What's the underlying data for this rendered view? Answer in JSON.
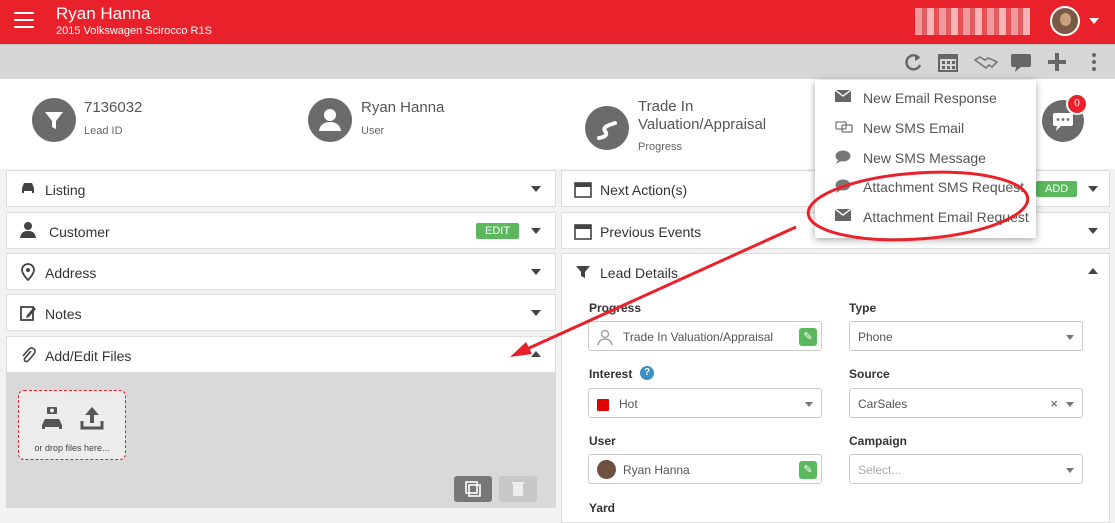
{
  "header": {
    "name": "Ryan Hanna",
    "vehicle": "2015 Volkswagen Scirocco R1S"
  },
  "toolbar": {
    "icons": [
      "refresh-icon",
      "calendar-icon",
      "handshake-icon",
      "chat-icon",
      "plus-icon",
      "more-vertical-icon"
    ]
  },
  "summary": {
    "lead": {
      "value": "7136032",
      "label": "Lead ID"
    },
    "user": {
      "value": "Ryan Hanna",
      "label": "User"
    },
    "progress": {
      "value_line1": "Trade In",
      "value_line2": "Valuation/Appraisal",
      "label": "Progress"
    },
    "chat_badge": "0"
  },
  "left_panels": {
    "listing": "Listing",
    "customer": "Customer",
    "customer_edit": "EDIT",
    "address": "Address",
    "notes": "Notes",
    "files": "Add/Edit Files",
    "dropzone_text": "or drop files here..."
  },
  "right_panels": {
    "next_actions": "Next Action(s)",
    "add": "ADD",
    "previous_events": "Previous Events",
    "lead_details": "Lead Details"
  },
  "lead_details": {
    "progress_label": "Progress",
    "progress_value": "Trade In Valuation/Appraisal",
    "type_label": "Type",
    "type_value": "Phone",
    "interest_label": "Interest",
    "interest_value": "Hot",
    "source_label": "Source",
    "source_value": "CarSales",
    "user_label": "User",
    "user_value": "Ryan Hanna",
    "campaign_label": "Campaign",
    "campaign_placeholder": "Select...",
    "yard_label": "Yard"
  },
  "menu": {
    "items": [
      {
        "label": "New Email Response",
        "icon": "envelope-icon"
      },
      {
        "label": "New SMS Email",
        "icon": "sms-email-icon"
      },
      {
        "label": "New SMS Message",
        "icon": "speech-bubble-icon"
      },
      {
        "label": "Attachment SMS Request",
        "icon": "speech-bubble-icon"
      },
      {
        "label": "Attachment Email Request",
        "icon": "envelope-icon"
      }
    ]
  },
  "colors": {
    "brand_red": "#e8212a",
    "success_green": "#5cb85c",
    "hot_red": "#e00000"
  }
}
